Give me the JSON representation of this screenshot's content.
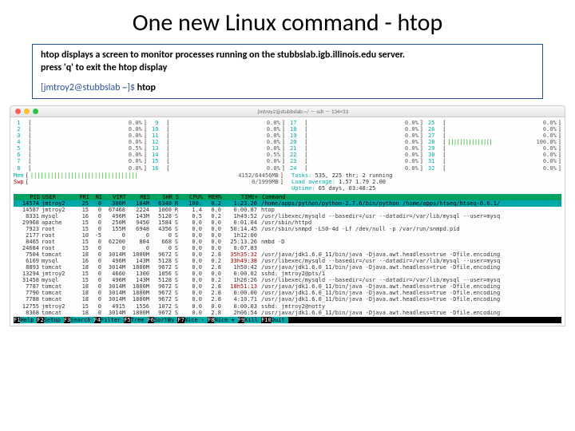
{
  "title": "One new Linux command - htop",
  "desc_l1": "htop displays a screen to monitor processes running on the stubbslab.igb.illinois.edu server.",
  "desc_l2": "press 'q' to exit the htop display",
  "prompt_user": "[jmtroy2@stubbslab ~]$ ",
  "prompt_cmd": "htop",
  "mac_title": "jmtroy2@stubbslab:~/ — ssh — 134×33",
  "cpu_left": [
    {
      "n": "1",
      "v": "0.0%"
    },
    {
      "n": "2",
      "v": "0.0%"
    },
    {
      "n": "3",
      "v": "0.0%"
    },
    {
      "n": "4",
      "v": "0.0%"
    },
    {
      "n": "5",
      "v": "0.5%"
    },
    {
      "n": "6",
      "v": "0.0%"
    },
    {
      "n": "7",
      "v": "0.0%"
    },
    {
      "n": "8",
      "v": "0.0%"
    }
  ],
  "cpu_mid": [
    {
      "n": "9",
      "v": "0.0%"
    },
    {
      "n": "10",
      "v": "0.0%"
    },
    {
      "n": "11",
      "v": "0.0%"
    },
    {
      "n": "12",
      "v": "0.0%"
    },
    {
      "n": "13",
      "v": "0.0%"
    },
    {
      "n": "14",
      "v": "0.5%"
    },
    {
      "n": "15",
      "v": "0.0%"
    },
    {
      "n": "16",
      "v": "0.0%"
    }
  ],
  "cpu_r1": [
    {
      "n": "17",
      "v": "0.0%"
    },
    {
      "n": "18",
      "v": "0.0%"
    },
    {
      "n": "19",
      "v": "0.0%"
    },
    {
      "n": "20",
      "v": "0.0%"
    },
    {
      "n": "21",
      "v": "0.0%"
    },
    {
      "n": "22",
      "v": "0.0%"
    },
    {
      "n": "23",
      "v": "0.0%"
    },
    {
      "n": "24",
      "v": "0.0%"
    }
  ],
  "cpu_r2": [
    {
      "n": "25",
      "v": "0.0%"
    },
    {
      "n": "26",
      "v": "0.0%"
    },
    {
      "n": "27",
      "v": "0.0%"
    },
    {
      "n": "28",
      "v": "100.0%",
      "full": true
    },
    {
      "n": "29",
      "v": "0.0%"
    },
    {
      "n": "30",
      "v": "0.0%"
    },
    {
      "n": "31",
      "v": "0.0%"
    },
    {
      "n": "32",
      "v": "0.0%"
    }
  ],
  "mem": {
    "label": "Mem",
    "fill": "||||||||||||||||||||||||||||||||",
    "val": "4152/64456MB"
  },
  "swp": {
    "label": "Swp",
    "val": "0/1999MB"
  },
  "sys": {
    "tasks_l": "Tasks: ",
    "tasks_v": "535, 225 thr; 2 running",
    "load_l": "Load average: ",
    "load_v": "1.57 1.79 2.00",
    "up_l": "Uptime: ",
    "up_v": "65 days, 03:48:25"
  },
  "hdr": {
    "pid": "PID",
    "user": "USER",
    "pri": "PRI",
    "ni": "NI",
    "virt": "VIRT",
    "res": "RES",
    "shr": "SHR",
    "s": "S",
    "cpu": "CPU%",
    "mem": "MEM%",
    "time": "TIME+",
    "cmd": "Command"
  },
  "procs": [
    {
      "pid": "14574",
      "user": "jmtroy2",
      "pri": "25",
      "ni": "0",
      "virt": "306M",
      "res": "104M",
      "shr": "6340",
      "s": "R",
      "cpu": "100.",
      "mem": "0.2",
      "time": "1:23.26",
      "cmd": "/home/apps/python/python-2.7.6/bin/python /home/apps/htseq/htseq-0.6.1/",
      "hl": true
    },
    {
      "pid": "14587",
      "user": "jmtroy2",
      "pri": "15",
      "ni": "0",
      "virt": "67468",
      "res": "2224",
      "shr": "1060",
      "s": "R",
      "cpu": "1.4",
      "mem": "0.0",
      "time": "0:00.87",
      "cmd": "htop"
    },
    {
      "pid": "8331",
      "user": "mysql",
      "pri": "16",
      "ni": "0",
      "virt": "496M",
      "res": "143M",
      "shr": "5128",
      "s": "S",
      "cpu": "0.5",
      "mem": "0.2",
      "time": "1h49:52",
      "cmd": "/usr/libexec/mysqld --basedir=/usr --datadir=/var/lib/mysql --user=mysq"
    },
    {
      "pid": "29968",
      "user": "apache",
      "pri": "15",
      "ni": "0",
      "virt": "250M",
      "res": "9450",
      "shr": "1584",
      "s": "S",
      "cpu": "0.0",
      "mem": "0.0",
      "time": "0:01.04",
      "cmd": "/usr/sbin/httpd"
    },
    {
      "pid": "7923",
      "user": "root",
      "pri": "15",
      "ni": "0",
      "virt": "155M",
      "res": "6948",
      "shr": "4356",
      "s": "S",
      "cpu": "0.0",
      "mem": "0.0",
      "time": "50:14.45",
      "cmd": "/usr/sbin/snmpd -LS0-4d -Lf /dev/null -p /var/run/snmpd.pid"
    },
    {
      "pid": "2177",
      "user": "root",
      "pri": "10",
      "ni": "-5",
      "virt": "0",
      "res": "0",
      "shr": "0",
      "s": "S",
      "cpu": "0.0",
      "mem": "0.0",
      "time": "1h12:00",
      "cmd": ""
    },
    {
      "pid": "8465",
      "user": "root",
      "pri": "15",
      "ni": "0",
      "virt": "62200",
      "res": "804",
      "shr": "668",
      "s": "S",
      "cpu": "0.0",
      "mem": "0.0",
      "time": "25:13.26",
      "cmd": "nmbd -D"
    },
    {
      "pid": "24684",
      "user": "root",
      "pri": "15",
      "ni": "0",
      "virt": "0",
      "res": "0",
      "shr": "0",
      "s": "S",
      "cpu": "0.0",
      "mem": "0.0",
      "time": "0:07.83",
      "cmd": ""
    },
    {
      "pid": "7504",
      "user": "tomcat",
      "pri": "18",
      "ni": "0",
      "virt": "3014M",
      "res": "1800M",
      "shr": "9672",
      "s": "S",
      "cpu": "0.0",
      "mem": "2.8",
      "time": "35h35:32",
      "cmd": "/usr/java/jdk1.6.0_11/bin/java -Djava.awt.headless=true -Dfile.encoding",
      "red": true
    },
    {
      "pid": "6169",
      "user": "mysql",
      "pri": "16",
      "ni": "0",
      "virt": "496M",
      "res": "143M",
      "shr": "5128",
      "s": "S",
      "cpu": "0.0",
      "mem": "0.2",
      "time": "33h49:38",
      "cmd": "/usr/libexec/mysqld --basedir=/usr --datadir=/var/lib/mysql --user=mysq",
      "red": true
    },
    {
      "pid": "8893",
      "user": "tomcat",
      "pri": "18",
      "ni": "0",
      "virt": "3014M",
      "res": "1800M",
      "shr": "9672",
      "s": "S",
      "cpu": "0.0",
      "mem": "2.8",
      "time": "1h50:42",
      "cmd": "/usr/java/jdk1.6.0_11/bin/java -Djava.awt.headless=true -Dfile.encoding"
    },
    {
      "pid": "13294",
      "user": "jmtroy2",
      "pri": "15",
      "ni": "0",
      "virt": "4660",
      "res": "1300",
      "shr": "1056",
      "s": "S",
      "cpu": "0.0",
      "mem": "0.0",
      "time": "0:00.02",
      "cmd": "sshd: jmtroy2@pts/1"
    },
    {
      "pid": "31458",
      "user": "mysql",
      "pri": "15",
      "ni": "0",
      "virt": "496M",
      "res": "143M",
      "shr": "5128",
      "s": "S",
      "cpu": "0.0",
      "mem": "0.2",
      "time": "1h26:26",
      "cmd": "/usr/libexec/mysqld --basedir=/usr --datadir=/var/lib/mysql --user=mysq"
    },
    {
      "pid": "7787",
      "user": "tomcat",
      "pri": "18",
      "ni": "0",
      "virt": "3014M",
      "res": "1800M",
      "shr": "9672",
      "s": "S",
      "cpu": "0.0",
      "mem": "2.8",
      "time": "18h51:13",
      "cmd": "/usr/java/jdk1.6.0_11/bin/java -Djava.awt.headless=true -Dfile.encoding",
      "red": true
    },
    {
      "pid": "7790",
      "user": "tomcat",
      "pri": "18",
      "ni": "0",
      "virt": "3014M",
      "res": "1800M",
      "shr": "9672",
      "s": "S",
      "cpu": "0.0",
      "mem": "2.8",
      "time": "0:00.00",
      "cmd": "/usr/java/jdk1.6.0_11/bin/java -Djava.awt.headless=true -Dfile.encoding"
    },
    {
      "pid": "7788",
      "user": "tomcat",
      "pri": "18",
      "ni": "0",
      "virt": "3014M",
      "res": "1800M",
      "shr": "9672",
      "s": "S",
      "cpu": "0.0",
      "mem": "2.8",
      "time": "4:10.71",
      "cmd": "/usr/java/jdk1.6.0_11/bin/java -Djava.awt.headless=true -Dfile.encoding"
    },
    {
      "pid": "12755",
      "user": "jmtroy2",
      "pri": "15",
      "ni": "0",
      "virt": "4915",
      "res": "1556",
      "shr": "1072",
      "s": "S",
      "cpu": "0.0",
      "mem": "0.0",
      "time": "0:00.03",
      "cmd": "sshd: jmtroy2@notty"
    },
    {
      "pid": "8368",
      "user": "tomcat",
      "pri": "18",
      "ni": "0",
      "virt": "3014M",
      "res": "1800M",
      "shr": "9672",
      "s": "S",
      "cpu": "0.0",
      "mem": "2.8",
      "time": "2h06:54",
      "cmd": "/usr/java/jdk1.6.0_11/bin/java -Djava.awt.headless=true -Dfile.encoding"
    }
  ],
  "fkeys": [
    {
      "k": "F1",
      "v": "Help"
    },
    {
      "k": "F2",
      "v": "Setup"
    },
    {
      "k": "F3",
      "v": "Search"
    },
    {
      "k": "F4",
      "v": "Filter"
    },
    {
      "k": "F5",
      "v": "Tree"
    },
    {
      "k": "F6",
      "v": "SortBy"
    },
    {
      "k": "F7",
      "v": "Nice -"
    },
    {
      "k": "F8",
      "v": "Nice +"
    },
    {
      "k": "F9",
      "v": "Kill"
    },
    {
      "k": "F10",
      "v": "Quit"
    }
  ]
}
